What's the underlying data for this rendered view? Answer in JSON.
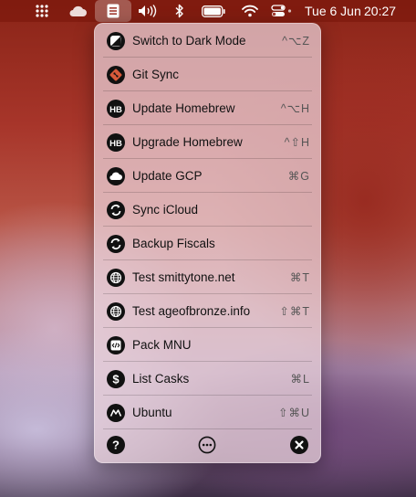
{
  "menubar": {
    "date": "Tue 6 Jun",
    "time": "20:27",
    "icons": [
      "dots-grid-icon",
      "cloud-icon",
      "app-menu-icon",
      "volume-icon",
      "bluetooth-icon",
      "battery-icon",
      "wifi-icon",
      "control-center-icon"
    ]
  },
  "menu": {
    "items": [
      {
        "label": "Switch to Dark Mode",
        "shortcut": "^⌥Z",
        "icon": "dark-mode-icon"
      },
      {
        "label": "Git Sync",
        "shortcut": "",
        "icon": "git-icon"
      },
      {
        "label": "Update Homebrew",
        "shortcut": "^⌥H",
        "icon": "homebrew-icon"
      },
      {
        "label": "Upgrade Homebrew",
        "shortcut": "^⇧H",
        "icon": "homebrew-icon"
      },
      {
        "label": "Update GCP",
        "shortcut": "⌘G",
        "icon": "cloud-icon"
      },
      {
        "label": "Sync iCloud",
        "shortcut": "",
        "icon": "sync-icon"
      },
      {
        "label": "Backup Fiscals",
        "shortcut": "",
        "icon": "sync-icon"
      },
      {
        "label": "Test smittytone.net",
        "shortcut": "⌘T",
        "icon": "globe-icon"
      },
      {
        "label": "Test ageofbronze.info",
        "shortcut": "⇧⌘T",
        "icon": "globe-icon"
      },
      {
        "label": "Pack MNU",
        "shortcut": "",
        "icon": "code-icon"
      },
      {
        "label": "List Casks",
        "shortcut": "⌘L",
        "icon": "dollar-icon"
      },
      {
        "label": "Ubuntu",
        "shortcut": "⇧⌘U",
        "icon": "ubuntu-icon"
      }
    ],
    "footer": [
      "help-icon",
      "more-icon",
      "close-icon"
    ]
  }
}
